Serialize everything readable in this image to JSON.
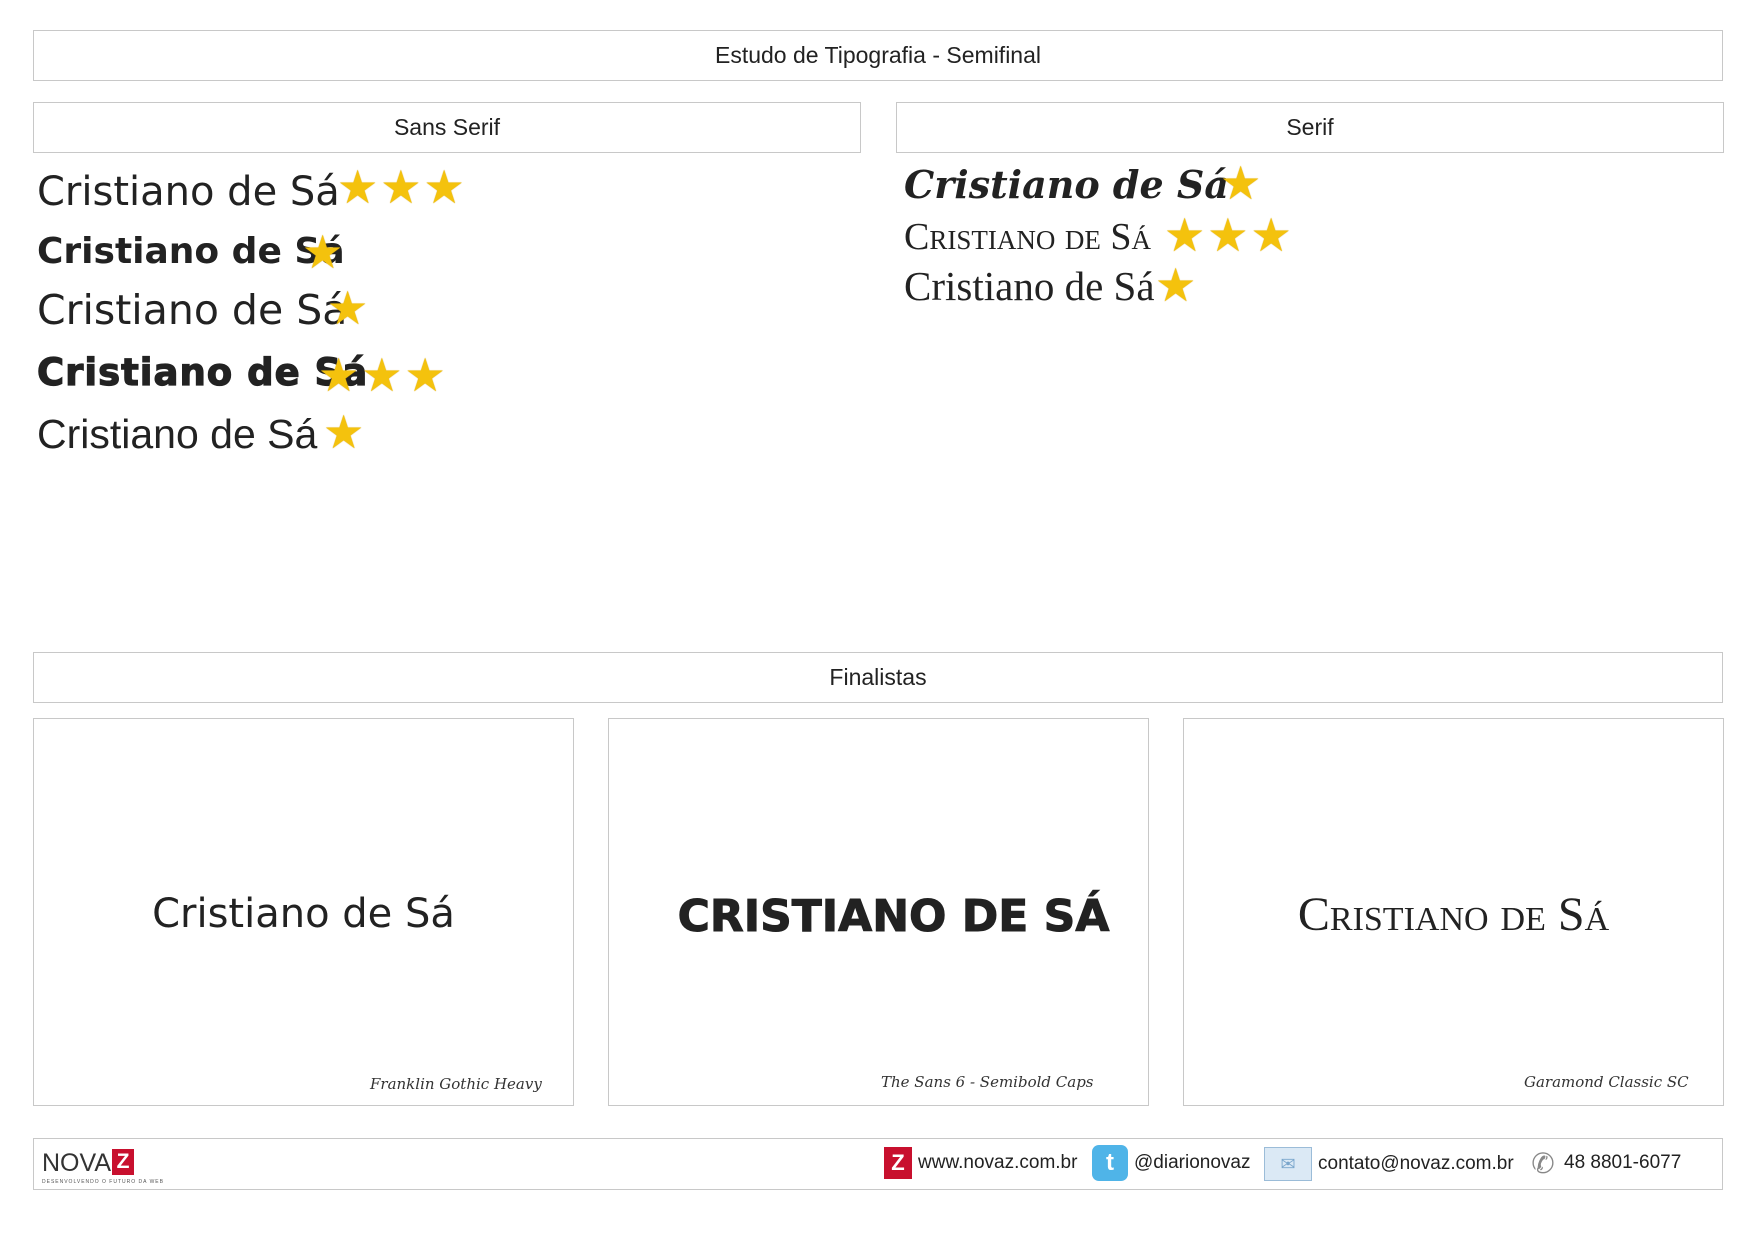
{
  "title": "Estudo de Tipografia - Semifinal",
  "sections": {
    "sans": "Sans Serif",
    "serif": "Serif",
    "finalists": "Finalistas"
  },
  "sans_samples": [
    {
      "text": "Cristiano de Sá",
      "stars": "★★★",
      "rating": 3
    },
    {
      "text": "Cristiano de Sá",
      "stars": "★",
      "rating": 1
    },
    {
      "text": "Cristiano de Sá",
      "stars": "★",
      "rating": 1
    },
    {
      "text": "Cristiano de Sá",
      "stars": "★★★",
      "rating": 3
    },
    {
      "text": "Cristiano de Sá",
      "stars": "★",
      "rating": 1
    }
  ],
  "serif_samples": [
    {
      "text": "Cristiano de Sá",
      "stars": "★",
      "rating": 1
    },
    {
      "text": "Cristiano de Sá",
      "stars": "★★★",
      "rating": 3
    },
    {
      "text": "Cristiano de Sá",
      "stars": "★",
      "rating": 1
    }
  ],
  "finalists": [
    {
      "text": "Cristiano de Sá",
      "caption": "Franklin Gothic Heavy"
    },
    {
      "text": "CRISTIANO DE SÁ",
      "caption": "The Sans 6 - Semibold Caps"
    },
    {
      "text": "Cristiano de Sá",
      "caption": "Garamond Classic SC"
    }
  ],
  "footer": {
    "logo_word": "NOVA",
    "logo_z": "Z",
    "logo_tagline": "DESENVOLVENDO O FUTURO DA WEB",
    "website": "www.novaz.com.br",
    "twitter": "@diarionovaz",
    "email": "contato@novaz.com.br",
    "phone": "48 8801-6077"
  },
  "icons": {
    "rating": "star-icon",
    "website": "novaz-z-icon",
    "twitter": "twitter-icon",
    "email": "envelope-icon",
    "phone": "phone-icon"
  },
  "colors": {
    "star": "#f4c20d",
    "brand_red": "#c8102e",
    "twitter_blue": "#4fb4e8",
    "border": "#c8c8c8"
  }
}
